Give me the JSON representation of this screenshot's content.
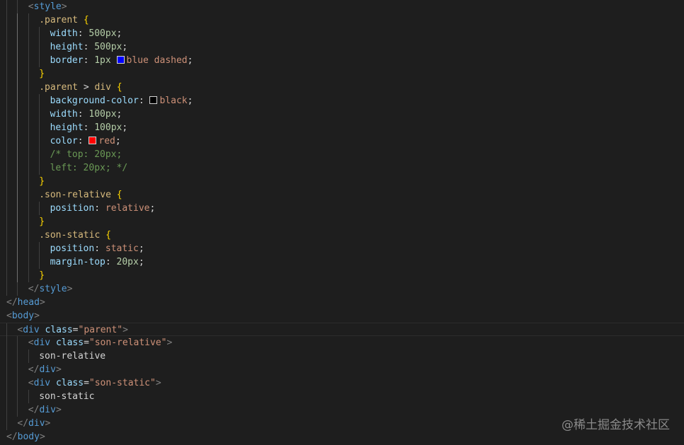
{
  "colors": {
    "background": "#1e1e1e",
    "tag": "#569cd6",
    "attribute": "#9cdcfe",
    "string": "#ce9178",
    "selector": "#d7ba7d",
    "brace": "#ffd700",
    "number": "#b5cea8",
    "comment": "#6a9955",
    "text": "#d4d4d4",
    "punctuation": "#808080"
  },
  "watermark": "@稀土掘金技术社区",
  "lines": [
    {
      "indent": 2,
      "tokens": [
        {
          "t": "<",
          "c": "punct"
        },
        {
          "t": "style",
          "c": "tag"
        },
        {
          "t": ">",
          "c": "punct"
        }
      ]
    },
    {
      "indent": 3,
      "tokens": [
        {
          "t": ".parent ",
          "c": "sel"
        },
        {
          "t": "{",
          "c": "brace"
        }
      ]
    },
    {
      "indent": 4,
      "tokens": [
        {
          "t": "width",
          "c": "prop"
        },
        {
          "t": ": ",
          "c": "text"
        },
        {
          "t": "500px",
          "c": "num"
        },
        {
          "t": ";",
          "c": "text"
        }
      ]
    },
    {
      "indent": 4,
      "tokens": [
        {
          "t": "height",
          "c": "prop"
        },
        {
          "t": ": ",
          "c": "text"
        },
        {
          "t": "500px",
          "c": "num"
        },
        {
          "t": ";",
          "c": "text"
        }
      ]
    },
    {
      "indent": 4,
      "tokens": [
        {
          "t": "border",
          "c": "prop"
        },
        {
          "t": ": ",
          "c": "text"
        },
        {
          "t": "1px ",
          "c": "num"
        },
        {
          "swatch": "#0000ff"
        },
        {
          "t": "blue dashed",
          "c": "val"
        },
        {
          "t": ";",
          "c": "text"
        }
      ]
    },
    {
      "indent": 3,
      "tokens": [
        {
          "t": "}",
          "c": "brace"
        }
      ]
    },
    {
      "indent": 3,
      "tokens": [
        {
          "t": ".parent ",
          "c": "sel"
        },
        {
          "t": "> ",
          "c": "text"
        },
        {
          "t": "div ",
          "c": "sel"
        },
        {
          "t": "{",
          "c": "brace"
        }
      ]
    },
    {
      "indent": 4,
      "tokens": [
        {
          "t": "background-color",
          "c": "prop"
        },
        {
          "t": ": ",
          "c": "text"
        },
        {
          "swatch": "#000000"
        },
        {
          "t": "black",
          "c": "val"
        },
        {
          "t": ";",
          "c": "text"
        }
      ]
    },
    {
      "indent": 4,
      "tokens": [
        {
          "t": "width",
          "c": "prop"
        },
        {
          "t": ": ",
          "c": "text"
        },
        {
          "t": "100px",
          "c": "num"
        },
        {
          "t": ";",
          "c": "text"
        }
      ]
    },
    {
      "indent": 4,
      "tokens": [
        {
          "t": "height",
          "c": "prop"
        },
        {
          "t": ": ",
          "c": "text"
        },
        {
          "t": "100px",
          "c": "num"
        },
        {
          "t": ";",
          "c": "text"
        }
      ]
    },
    {
      "indent": 4,
      "tokens": [
        {
          "t": "color",
          "c": "prop"
        },
        {
          "t": ": ",
          "c": "text"
        },
        {
          "swatch": "#ff0000"
        },
        {
          "t": "red",
          "c": "val"
        },
        {
          "t": ";",
          "c": "text"
        }
      ]
    },
    {
      "indent": 4,
      "tokens": [
        {
          "t": "/* top: 20px;",
          "c": "comment"
        }
      ]
    },
    {
      "indent": 4,
      "tokens": [
        {
          "t": "left: 20px; */",
          "c": "comment"
        }
      ]
    },
    {
      "indent": 3,
      "tokens": [
        {
          "t": "}",
          "c": "brace"
        }
      ]
    },
    {
      "indent": 3,
      "tokens": [
        {
          "t": ".son-relative ",
          "c": "sel"
        },
        {
          "t": "{",
          "c": "brace"
        }
      ]
    },
    {
      "indent": 4,
      "tokens": [
        {
          "t": "position",
          "c": "prop"
        },
        {
          "t": ": ",
          "c": "text"
        },
        {
          "t": "relative",
          "c": "val"
        },
        {
          "t": ";",
          "c": "text"
        }
      ]
    },
    {
      "indent": 3,
      "tokens": [
        {
          "t": "}",
          "c": "brace"
        }
      ]
    },
    {
      "indent": 3,
      "tokens": [
        {
          "t": ".son-static ",
          "c": "sel"
        },
        {
          "t": "{",
          "c": "brace"
        }
      ]
    },
    {
      "indent": 4,
      "tokens": [
        {
          "t": "position",
          "c": "prop"
        },
        {
          "t": ": ",
          "c": "text"
        },
        {
          "t": "static",
          "c": "val"
        },
        {
          "t": ";",
          "c": "text"
        }
      ]
    },
    {
      "indent": 4,
      "tokens": [
        {
          "t": "margin-top",
          "c": "prop"
        },
        {
          "t": ": ",
          "c": "text"
        },
        {
          "t": "20px",
          "c": "num"
        },
        {
          "t": ";",
          "c": "text"
        }
      ]
    },
    {
      "indent": 3,
      "tokens": [
        {
          "t": "}",
          "c": "brace"
        }
      ]
    },
    {
      "indent": 2,
      "tokens": [
        {
          "t": "</",
          "c": "punct"
        },
        {
          "t": "style",
          "c": "tag"
        },
        {
          "t": ">",
          "c": "punct"
        }
      ]
    },
    {
      "indent": 0,
      "tokens": [
        {
          "t": "</",
          "c": "punct"
        },
        {
          "t": "head",
          "c": "tag"
        },
        {
          "t": ">",
          "c": "punct"
        }
      ]
    },
    {
      "indent": 0,
      "tokens": [
        {
          "t": "<",
          "c": "punct"
        },
        {
          "t": "body",
          "c": "tag"
        },
        {
          "t": ">",
          "c": "punct"
        }
      ]
    },
    {
      "indent": 1,
      "current": true,
      "tokens": [
        {
          "t": "<",
          "c": "punct"
        },
        {
          "t": "div",
          "c": "tag"
        },
        {
          "t": " ",
          "c": "text"
        },
        {
          "t": "class",
          "c": "attr"
        },
        {
          "t": "=",
          "c": "text"
        },
        {
          "t": "\"parent\"",
          "c": "string"
        },
        {
          "t": ">",
          "c": "punct"
        }
      ]
    },
    {
      "indent": 2,
      "tokens": [
        {
          "t": "<",
          "c": "punct"
        },
        {
          "t": "div",
          "c": "tag"
        },
        {
          "t": " ",
          "c": "text"
        },
        {
          "t": "class",
          "c": "attr"
        },
        {
          "t": "=",
          "c": "text"
        },
        {
          "t": "\"son-relative\"",
          "c": "string"
        },
        {
          "t": ">",
          "c": "punct"
        }
      ]
    },
    {
      "indent": 3,
      "tokens": [
        {
          "t": "son-relative",
          "c": "text"
        }
      ]
    },
    {
      "indent": 2,
      "tokens": [
        {
          "t": "</",
          "c": "punct"
        },
        {
          "t": "div",
          "c": "tag"
        },
        {
          "t": ">",
          "c": "punct"
        }
      ]
    },
    {
      "indent": 2,
      "tokens": [
        {
          "t": "<",
          "c": "punct"
        },
        {
          "t": "div",
          "c": "tag"
        },
        {
          "t": " ",
          "c": "text"
        },
        {
          "t": "class",
          "c": "attr"
        },
        {
          "t": "=",
          "c": "text"
        },
        {
          "t": "\"son-static\"",
          "c": "string"
        },
        {
          "t": ">",
          "c": "punct"
        }
      ]
    },
    {
      "indent": 3,
      "tokens": [
        {
          "t": "son-static",
          "c": "text"
        }
      ]
    },
    {
      "indent": 2,
      "tokens": [
        {
          "t": "</",
          "c": "punct"
        },
        {
          "t": "div",
          "c": "tag"
        },
        {
          "t": ">",
          "c": "punct"
        }
      ]
    },
    {
      "indent": 1,
      "tokens": [
        {
          "t": "</",
          "c": "punct"
        },
        {
          "t": "div",
          "c": "tag"
        },
        {
          "t": ">",
          "c": "punct"
        }
      ]
    },
    {
      "indent": 0,
      "tokens": [
        {
          "t": "</",
          "c": "punct"
        },
        {
          "t": "body",
          "c": "tag"
        },
        {
          "t": ">",
          "c": "punct"
        }
      ]
    }
  ]
}
